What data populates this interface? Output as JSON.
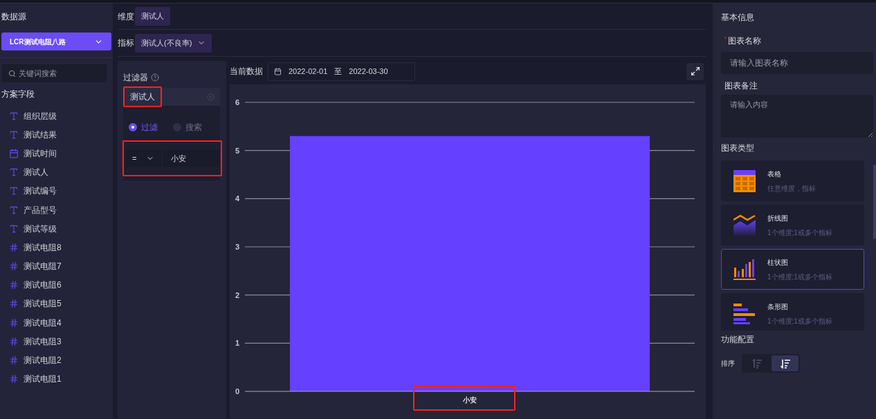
{
  "left": {
    "title": "数据源",
    "source": "LCR测试电阻八路",
    "search": {
      "placeholder": "关键词搜索"
    },
    "fields_title": "方案字段",
    "fields": [
      {
        "kind": "text",
        "label": "组织层级"
      },
      {
        "kind": "text",
        "label": "测试结果"
      },
      {
        "kind": "date",
        "label": "测试时间"
      },
      {
        "kind": "text",
        "label": "测试人"
      },
      {
        "kind": "text",
        "label": "测试编号"
      },
      {
        "kind": "text",
        "label": "产品型号"
      },
      {
        "kind": "text",
        "label": "测试等级"
      },
      {
        "kind": "number",
        "label": "测试电阻8"
      },
      {
        "kind": "number",
        "label": "测试电阻7"
      },
      {
        "kind": "number",
        "label": "测试电阻6"
      },
      {
        "kind": "number",
        "label": "测试电阻5"
      },
      {
        "kind": "number",
        "label": "测试电阻4"
      },
      {
        "kind": "number",
        "label": "测试电阻3"
      },
      {
        "kind": "number",
        "label": "测试电阻2"
      },
      {
        "kind": "number",
        "label": "测试电阻1"
      }
    ]
  },
  "dimension": {
    "label": "维度",
    "value": "测试人"
  },
  "metric": {
    "label": "指标",
    "value": "测试人(不良率)"
  },
  "filter": {
    "title": "过滤器",
    "tag": "测试人",
    "tag_highlighted": true,
    "modes": [
      {
        "label": "过滤",
        "selected": true
      },
      {
        "label": "搜索",
        "selected": false
      }
    ],
    "operator": "=",
    "value": "小安",
    "condition_highlighted": true
  },
  "current": {
    "label": "当前数据",
    "from": "2022-02-01",
    "sep": "至",
    "to": "2022-03-30"
  },
  "chart_data": {
    "type": "bar",
    "categories": [
      "小安"
    ],
    "values": [
      5.3
    ],
    "ylim": [
      0,
      6
    ],
    "yticks": [
      0,
      1,
      2,
      3,
      4,
      5,
      6
    ],
    "grid": true
  },
  "chart_label_highlighted": true,
  "right": {
    "title": "基本信息",
    "name_label": "图表名称",
    "name_required": true,
    "name_placeholder": "请输入图表名称",
    "note_label": "图表备注",
    "note_placeholder": "请输入内容",
    "types_title": "图表类型",
    "types": [
      {
        "kind": "table",
        "name": "表格",
        "desc": "任意维度，指标",
        "selected": false
      },
      {
        "kind": "line",
        "name": "折线图",
        "desc": "1个维度;1或多个指标",
        "selected": false
      },
      {
        "kind": "column",
        "name": "柱状图",
        "desc": "1个维度;1或多个指标",
        "selected": true
      },
      {
        "kind": "hbar",
        "name": "条形图",
        "desc": "1个维度;1或多个指标",
        "selected": false
      }
    ],
    "config_title": "功能配置",
    "sort_label": "排序",
    "sort": [
      {
        "kind": "asc",
        "selected": false
      },
      {
        "kind": "desc",
        "selected": true
      }
    ]
  }
}
